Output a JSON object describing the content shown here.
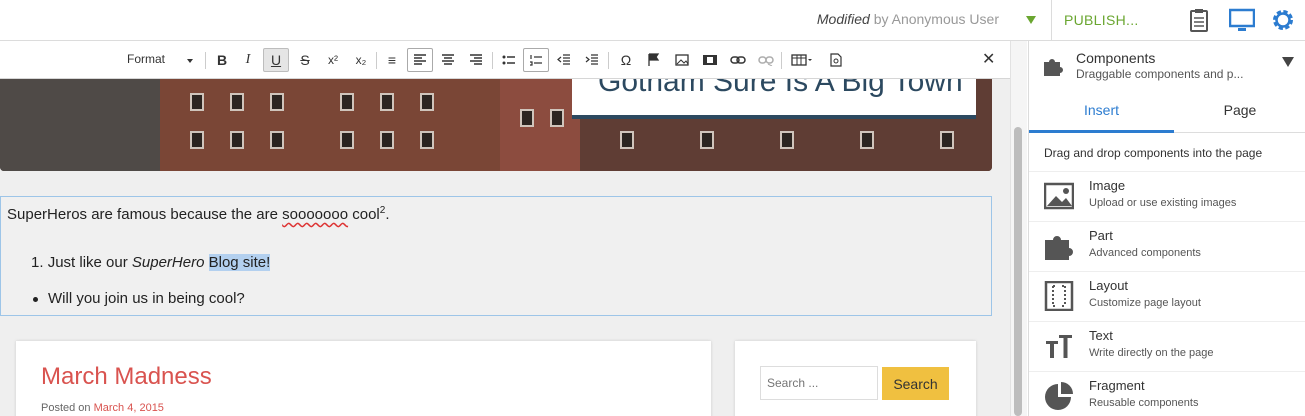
{
  "topbar": {
    "status_modified": "Modified",
    "status_by": "by Anonymous User",
    "publish": "PUBLISH...",
    "icons": [
      "clipboard-icon",
      "monitor-icon",
      "gear-icon"
    ],
    "accent": "#6aa630",
    "icon_color": "#2c7cd0"
  },
  "toolbar": {
    "format_label": "Format",
    "buttons": [
      "B",
      "I",
      "U",
      "S",
      "x²",
      "x₂",
      "Ω"
    ]
  },
  "hero": {
    "title": "Gotham Sure Is A Big Town"
  },
  "content": {
    "p1_text": "SuperHeros are famous because the are ",
    "p1_misspelled": "sooooooo",
    "p1_cool": " cool",
    "p1_sup": "2",
    "p1_period": ".",
    "li1_num": "1.",
    "li1_pre": "Just like our ",
    "li1_em": "SuperHero",
    "li1_sel": "Blog site!",
    "li2": "Will you join us in being cool?"
  },
  "post": {
    "title": "March Madness",
    "posted_on": "Posted on",
    "date": "March 4, 2015"
  },
  "search": {
    "placeholder": "Search ...",
    "button": "Search"
  },
  "panel": {
    "title": "Components",
    "subtitle": "Draggable components and p...",
    "tabs": {
      "insert": "Insert",
      "page": "Page"
    },
    "hint": "Drag and drop components into the page",
    "components": [
      {
        "name": "Image",
        "desc": "Upload or use existing images"
      },
      {
        "name": "Part",
        "desc": "Advanced components"
      },
      {
        "name": "Layout",
        "desc": "Customize page layout"
      },
      {
        "name": "Text",
        "desc": "Write directly on the page"
      },
      {
        "name": "Fragment",
        "desc": "Reusable components"
      }
    ]
  }
}
